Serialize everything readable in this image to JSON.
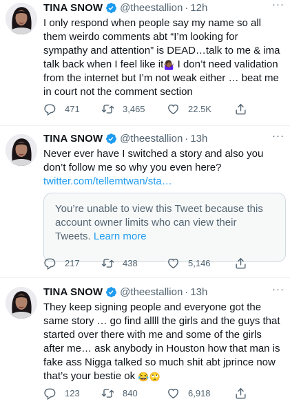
{
  "tweets": [
    {
      "name": "TINA SNOW",
      "handle": "@theestallion",
      "dot": "·",
      "time": "12h",
      "more": "···",
      "text_parts": [
        "I only respond when people say my name so all them weirdo comments abt “I’m looking for sympathy and attention” is DEAD…talk to me & ima talk back when I feel like it",
        " I don’t need validation from the internet but I’m not weak either … beat me in court not the comment section"
      ],
      "emoji": "🤷🏾‍♀️",
      "replies": "471",
      "retweets": "3,465",
      "likes": "22.5K"
    },
    {
      "name": "TINA SNOW",
      "handle": "@theestallion",
      "dot": "·",
      "time": "13h",
      "more": "···",
      "text": "Never ever have I switched a story and also you don’t follow me so why you even here? ",
      "link": "twitter.com/tellemtwan/sta…",
      "notice": "You’re unable to view this Tweet because this account owner limits who can view their Tweets. ",
      "learn_more": "Learn more",
      "replies": "217",
      "retweets": "438",
      "likes": "5,146"
    },
    {
      "name": "TINA SNOW",
      "handle": "@theestallion",
      "dot": "·",
      "time": "13h",
      "more": "···",
      "text": "They keep signing people and everyone got the same story … go find allll the girls and the guys that started over there with me and some of the girls after me… ask anybody in Houston how that man is fake ass Nigga talked so much shit abt jprince now that’s your bestie ok ",
      "emojis": "😂🙄",
      "replies": "123",
      "retweets": "840",
      "likes": "6,918"
    }
  ],
  "colors": {
    "text": "#0f1419",
    "secondary": "#536471",
    "link": "#1d9bf0",
    "verified": "#1d9bf0",
    "notice_bg": "#f7f9f9",
    "divider": "#eff3f4"
  },
  "icons": [
    "verified-badge-icon",
    "more-icon",
    "reply-icon",
    "retweet-icon",
    "like-icon",
    "share-icon"
  ]
}
